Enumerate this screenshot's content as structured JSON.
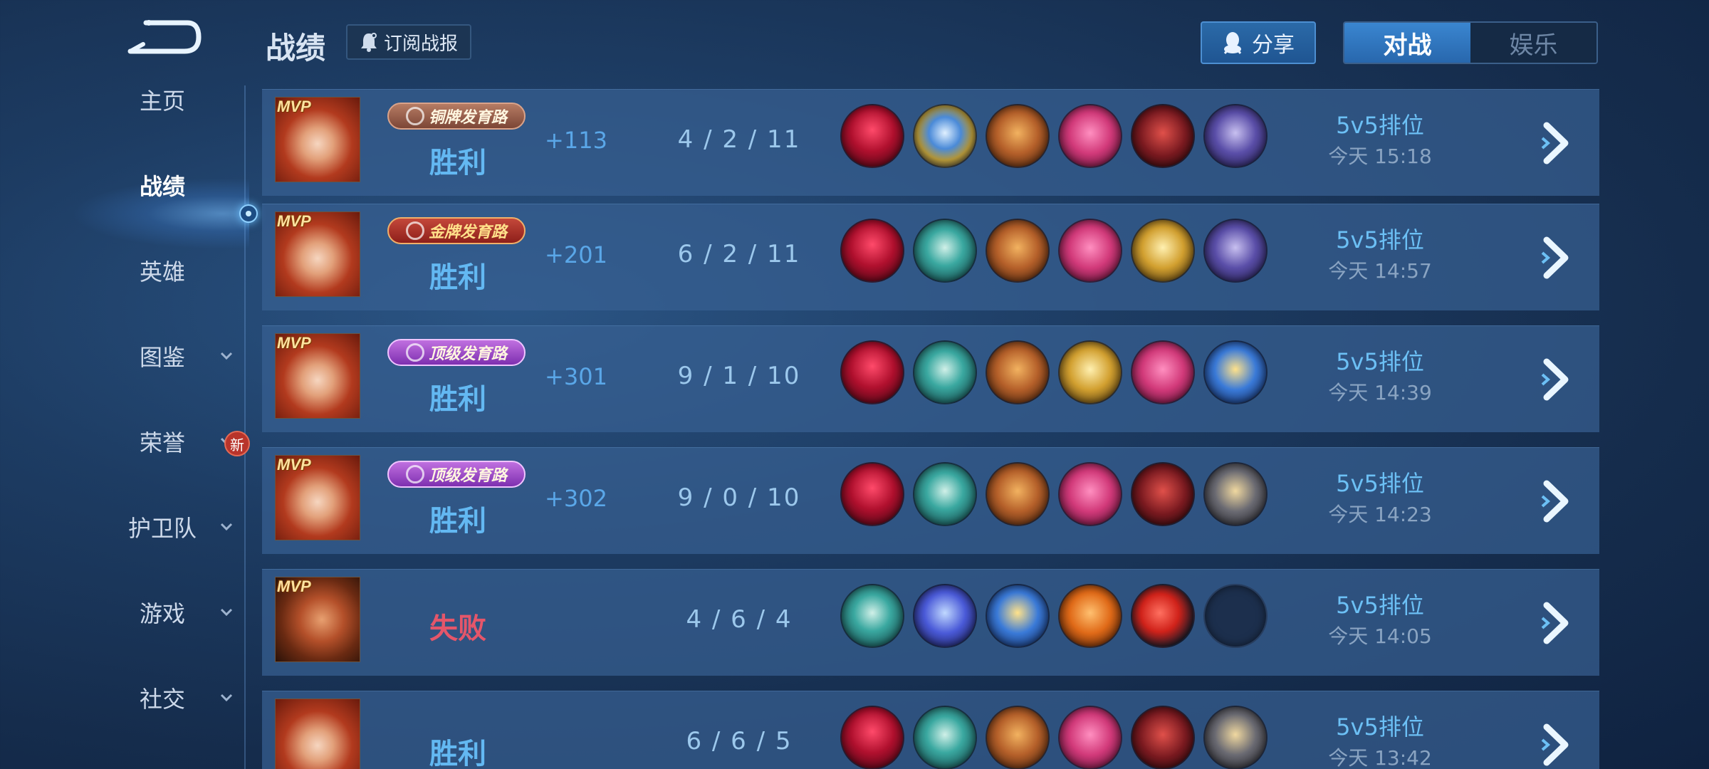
{
  "header": {
    "title": "战绩",
    "subscribe_label": "订阅战报",
    "share_label": "分享",
    "tabs": [
      {
        "label": "对战",
        "active": true
      },
      {
        "label": "娱乐",
        "active": false
      }
    ]
  },
  "sidebar": {
    "items": [
      {
        "label": "主页",
        "has_dropdown": false,
        "active": false
      },
      {
        "label": "战绩",
        "has_dropdown": false,
        "active": true
      },
      {
        "label": "英雄",
        "has_dropdown": false,
        "active": false
      },
      {
        "label": "图鉴",
        "has_dropdown": true,
        "active": false
      },
      {
        "label": "荣誉",
        "has_dropdown": true,
        "active": false,
        "badge": "新"
      },
      {
        "label": "护卫队",
        "has_dropdown": true,
        "active": false
      },
      {
        "label": "游戏",
        "has_dropdown": true,
        "active": false
      },
      {
        "label": "社交",
        "has_dropdown": true,
        "active": false
      }
    ]
  },
  "matches": [
    {
      "mvp": "MVP",
      "badge": "铜牌发育路",
      "badge_tier": "bronze",
      "result": "胜利",
      "points": "+113",
      "kda": "4 / 2 / 11",
      "mode": "5v5排位",
      "time": "今天 15:18",
      "items": [
        "crimson-wing",
        "blue-gold-armor",
        "bronze-blade",
        "pink-spear",
        "dark-red-claw",
        "purple-armor"
      ]
    },
    {
      "mvp": "MVP",
      "badge": "金牌发育路",
      "badge_tier": "gold",
      "result": "胜利",
      "points": "+201",
      "kda": "6 / 2 / 11",
      "mode": "5v5排位",
      "time": "今天 14:57",
      "items": [
        "crimson-wing",
        "teal-boots",
        "bronze-blade",
        "pink-spear",
        "gold-sword",
        "purple-armor"
      ]
    },
    {
      "mvp": "MVP",
      "badge": "顶级发育路",
      "badge_tier": "top",
      "result": "胜利",
      "points": "+301",
      "kda": "9 / 1 / 10",
      "mode": "5v5排位",
      "time": "今天 14:39",
      "items": [
        "crimson-wing",
        "teal-boots",
        "bronze-blade",
        "gold-sword",
        "pink-spear",
        "blue-gold-star"
      ]
    },
    {
      "mvp": "MVP",
      "badge": "顶级发育路",
      "badge_tier": "top",
      "result": "胜利",
      "points": "+302",
      "kda": "9 / 0 / 10",
      "mode": "5v5排位",
      "time": "今天 14:23",
      "items": [
        "crimson-wing",
        "teal-boots",
        "bronze-blade",
        "pink-spear",
        "dark-red-claw",
        "grey-armor"
      ]
    },
    {
      "mvp": "MVP",
      "badge": "",
      "badge_tier": "",
      "result": "失败",
      "points": "",
      "kda": "4 / 6 / 4",
      "mode": "5v5排位",
      "time": "今天 14:05",
      "items": [
        "teal-boots",
        "blue-spear",
        "blue-gold-star",
        "orange-bow",
        "red-crystal",
        "empty"
      ]
    },
    {
      "mvp": "",
      "badge": "",
      "badge_tier": "",
      "result": "胜利",
      "points": "",
      "kda": "6 / 6 / 5",
      "mode": "5v5排位",
      "time": "今天 13:42",
      "items": [
        "crimson-wing",
        "teal-boots",
        "bronze-blade",
        "pink-spear",
        "dark-red-claw",
        "grey-armor"
      ]
    }
  ],
  "colors": {
    "win": "#63b8f2",
    "lose": "#e5566a",
    "accent": "#3a86d0"
  }
}
